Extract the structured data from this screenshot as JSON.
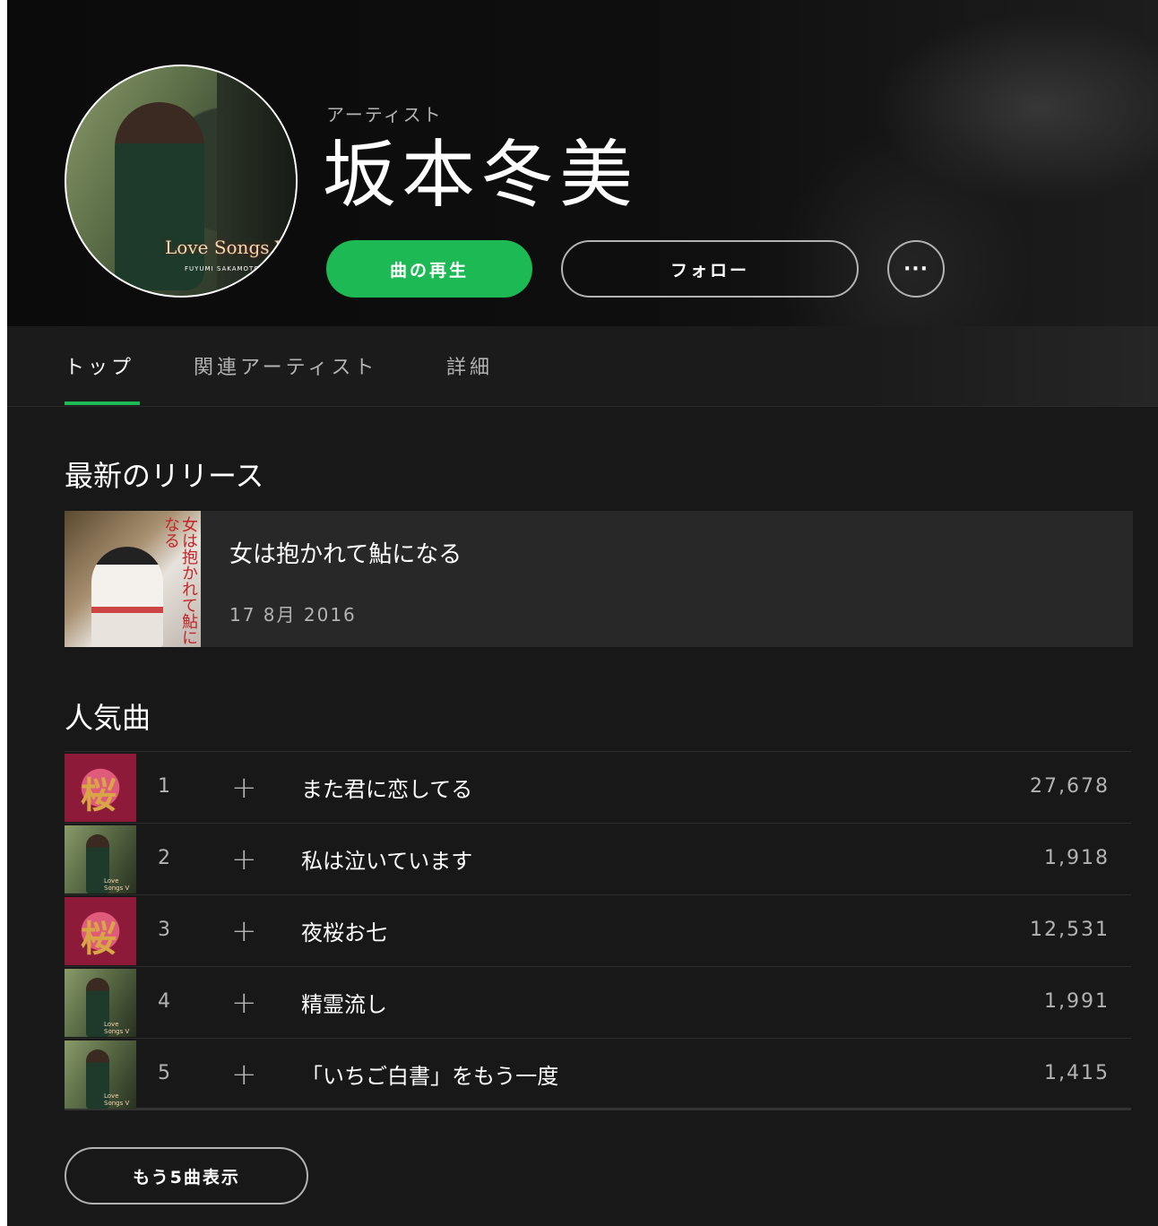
{
  "header": {
    "artist_label": "アーティスト",
    "artist_name": "坂本冬美",
    "avatar_cover_text": "Love Songs V",
    "avatar_cover_sub": "FUYUMI SAKAMOTO",
    "play_label": "曲の再生",
    "follow_label": "フォロー",
    "more_label": "···"
  },
  "tabs": [
    {
      "label": "トップ",
      "active": true
    },
    {
      "label": "関連アーティスト",
      "active": false
    },
    {
      "label": "詳細",
      "active": false
    }
  ],
  "latest_release": {
    "section_title": "最新のリリース",
    "title": "女は抱かれて鮎になる",
    "date": "17 8月 2016",
    "art_text": "女は抱かれて鮎になる"
  },
  "popular": {
    "section_title": "人気曲",
    "tracks": [
      {
        "num": "1",
        "title": "また君に恋してる",
        "plays": "27,678",
        "art": "sakura"
      },
      {
        "num": "2",
        "title": "私は泣いています",
        "plays": "1,918",
        "art": "love"
      },
      {
        "num": "3",
        "title": "夜桜お七",
        "plays": "12,531",
        "art": "sakura"
      },
      {
        "num": "4",
        "title": "精霊流し",
        "plays": "1,991",
        "art": "love"
      },
      {
        "num": "5",
        "title": "「いちご白書」をもう一度",
        "plays": "1,415",
        "art": "love"
      }
    ],
    "add_symbol": "+",
    "sakura_glyph": "桜",
    "love_mini_text": "Love Songs V",
    "show_more_label": "もう5曲表示"
  },
  "colors": {
    "accent": "#1db954",
    "background": "#181818",
    "card": "#282828",
    "muted_text": "#b3b3b3"
  }
}
